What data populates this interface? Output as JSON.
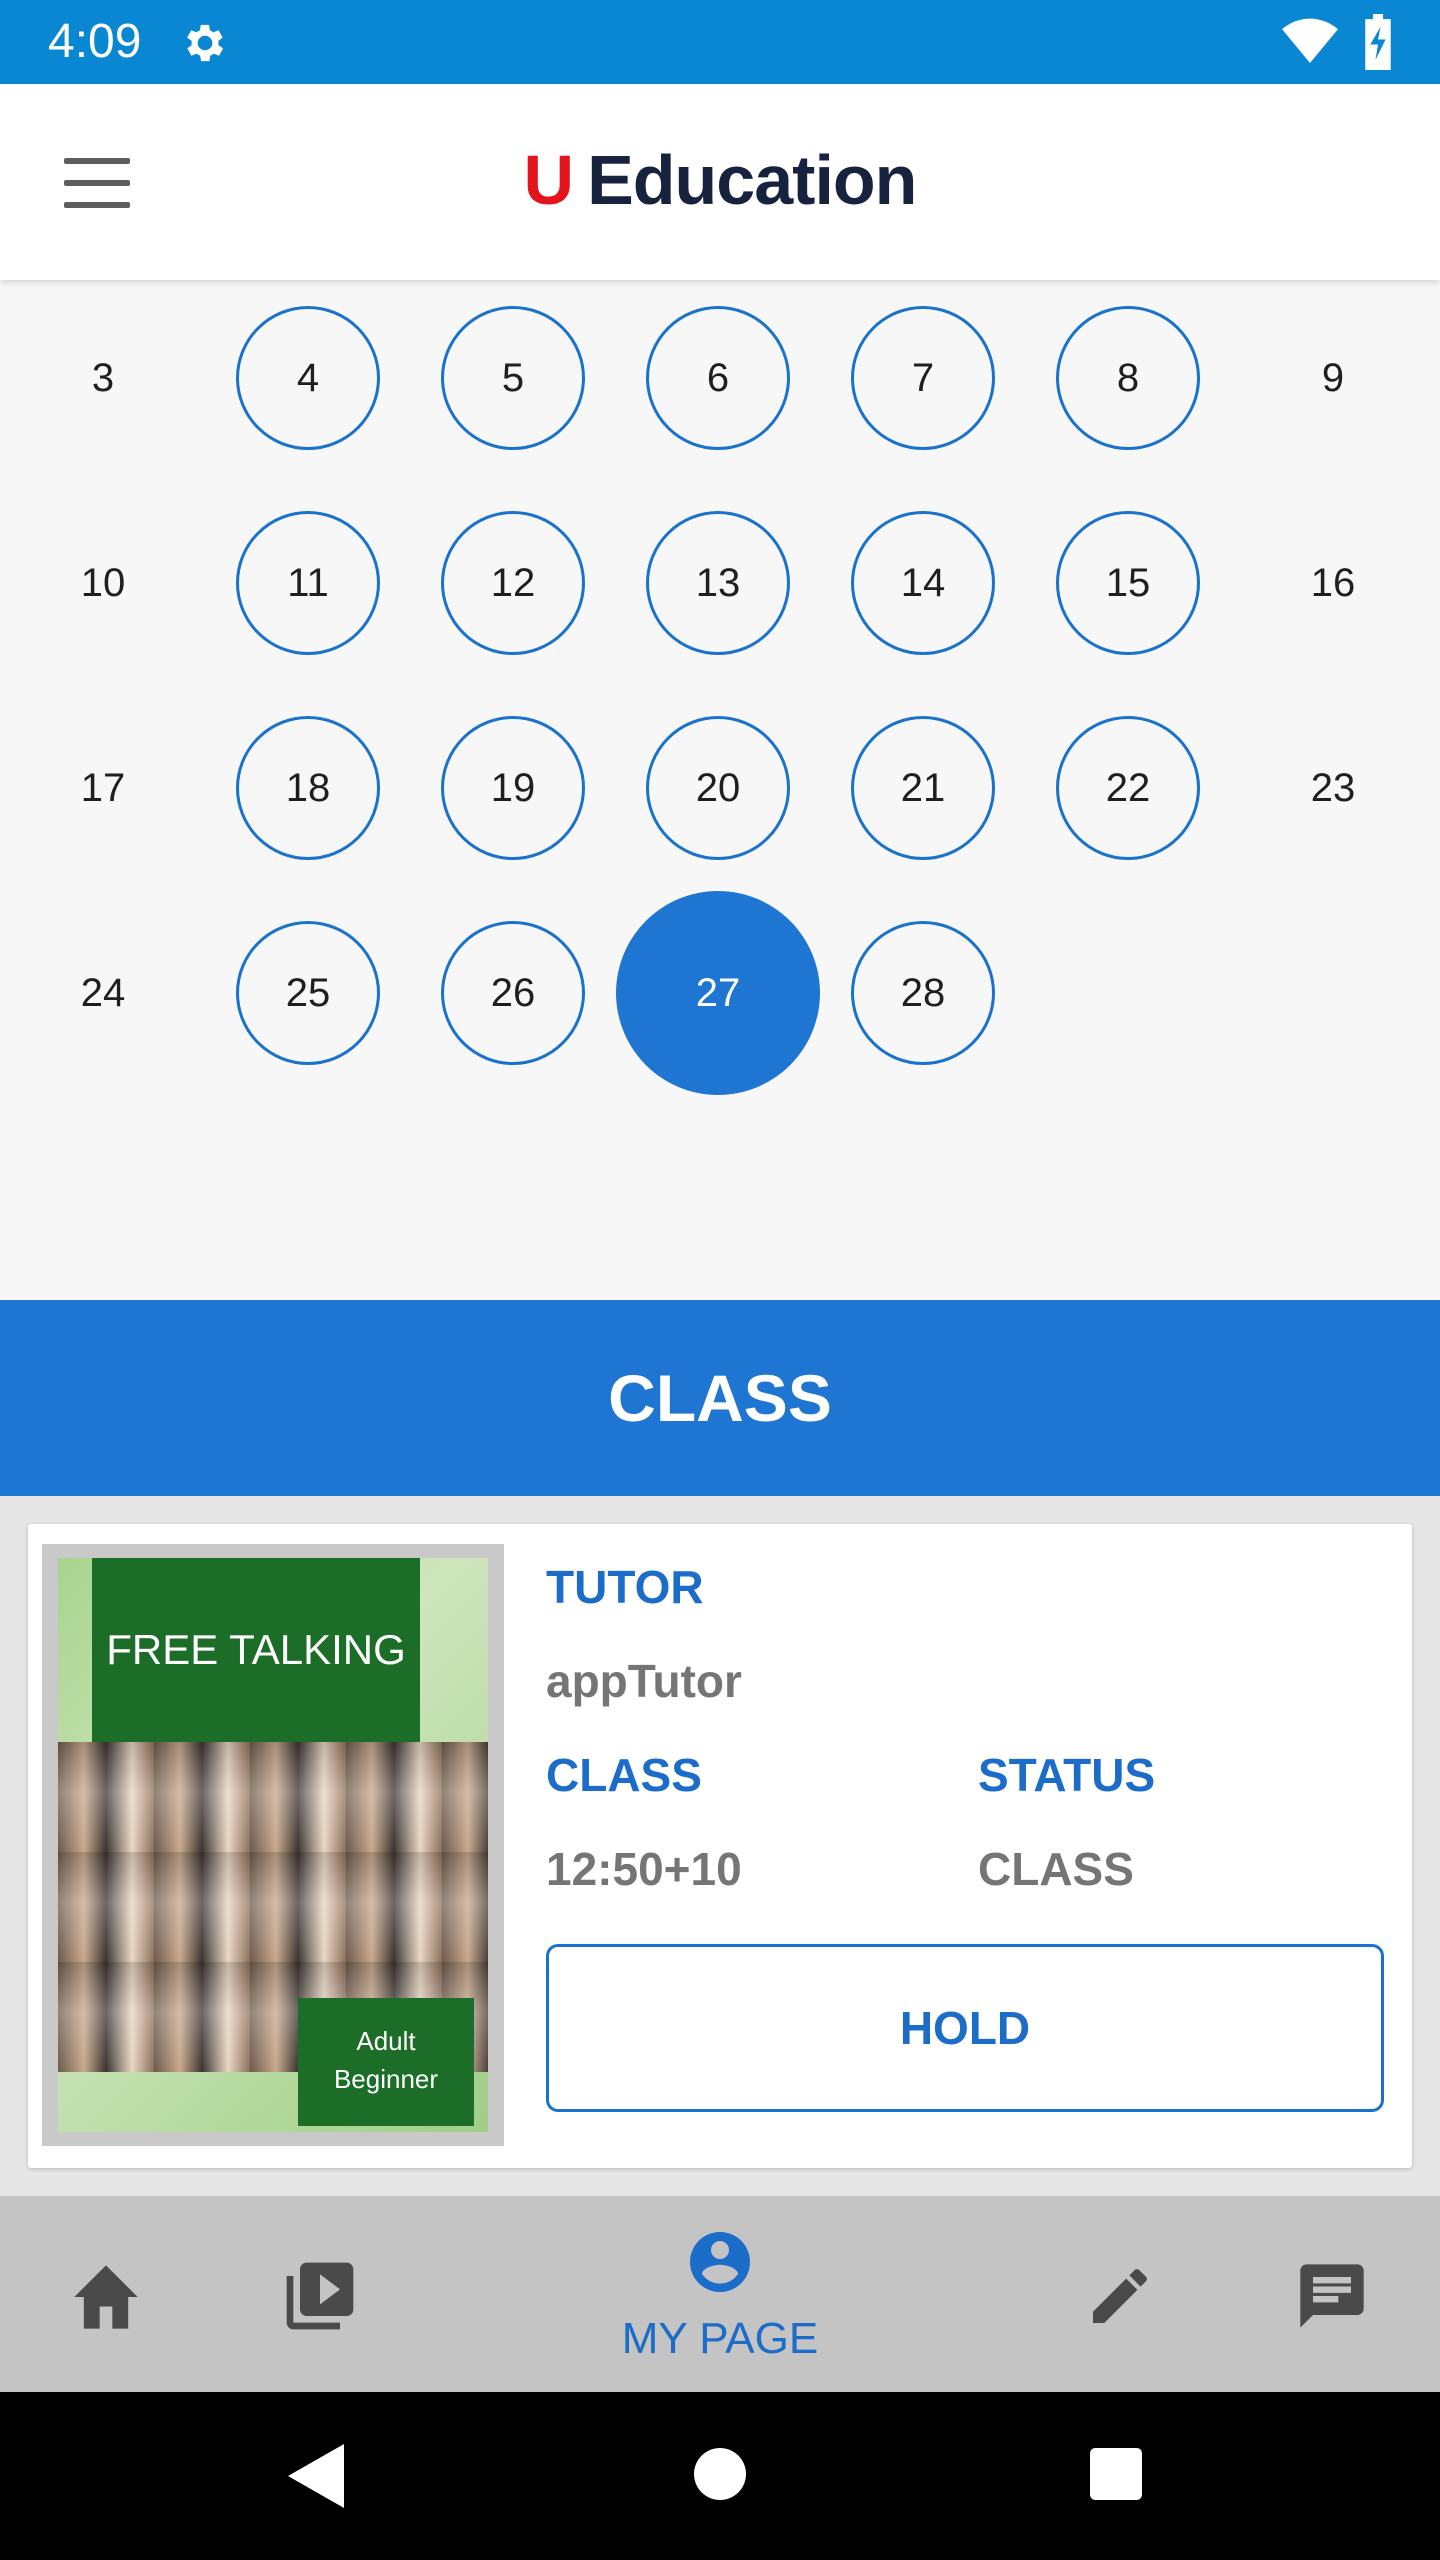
{
  "status_bar": {
    "time": "4:09"
  },
  "header": {
    "logo_u": "U",
    "logo_text": "Education"
  },
  "calendar": {
    "rows": [
      [
        {
          "day": "3",
          "available": false
        },
        {
          "day": "4",
          "available": true
        },
        {
          "day": "5",
          "available": true
        },
        {
          "day": "6",
          "available": true
        },
        {
          "day": "7",
          "available": true
        },
        {
          "day": "8",
          "available": true
        },
        {
          "day": "9",
          "available": false
        }
      ],
      [
        {
          "day": "10",
          "available": false
        },
        {
          "day": "11",
          "available": true
        },
        {
          "day": "12",
          "available": true
        },
        {
          "day": "13",
          "available": true
        },
        {
          "day": "14",
          "available": true
        },
        {
          "day": "15",
          "available": true
        },
        {
          "day": "16",
          "available": false
        }
      ],
      [
        {
          "day": "17",
          "available": false
        },
        {
          "day": "18",
          "available": true
        },
        {
          "day": "19",
          "available": true
        },
        {
          "day": "20",
          "available": true
        },
        {
          "day": "21",
          "available": true
        },
        {
          "day": "22",
          "available": true
        },
        {
          "day": "23",
          "available": false
        }
      ],
      [
        {
          "day": "24",
          "available": false
        },
        {
          "day": "25",
          "available": true
        },
        {
          "day": "26",
          "available": true
        },
        {
          "day": "27",
          "available": true,
          "selected": true
        },
        {
          "day": "28",
          "available": true
        }
      ]
    ]
  },
  "class_section": {
    "title": "CLASS",
    "card": {
      "thumbnail": {
        "title": "FREE TALKING",
        "level_line1": "Adult",
        "level_line2": "Beginner"
      },
      "tutor_label": "TUTOR",
      "tutor_value": "appTutor",
      "class_label": "CLASS",
      "class_value": "12:50+10",
      "status_label": "STATUS",
      "status_value": "CLASS",
      "hold_button": "HOLD"
    }
  },
  "bottom_nav": {
    "items": [
      {
        "icon": "home-icon"
      },
      {
        "icon": "video-library-icon"
      },
      {
        "icon": "account-circle-icon",
        "label": "MY PAGE",
        "active": true
      },
      {
        "icon": "pencil-icon"
      },
      {
        "icon": "message-icon"
      }
    ]
  },
  "colors": {
    "primary": "#1f76d2",
    "status_bar": "#0a87d3",
    "logo_red": "#e3141b",
    "logo_navy": "#16223e"
  }
}
